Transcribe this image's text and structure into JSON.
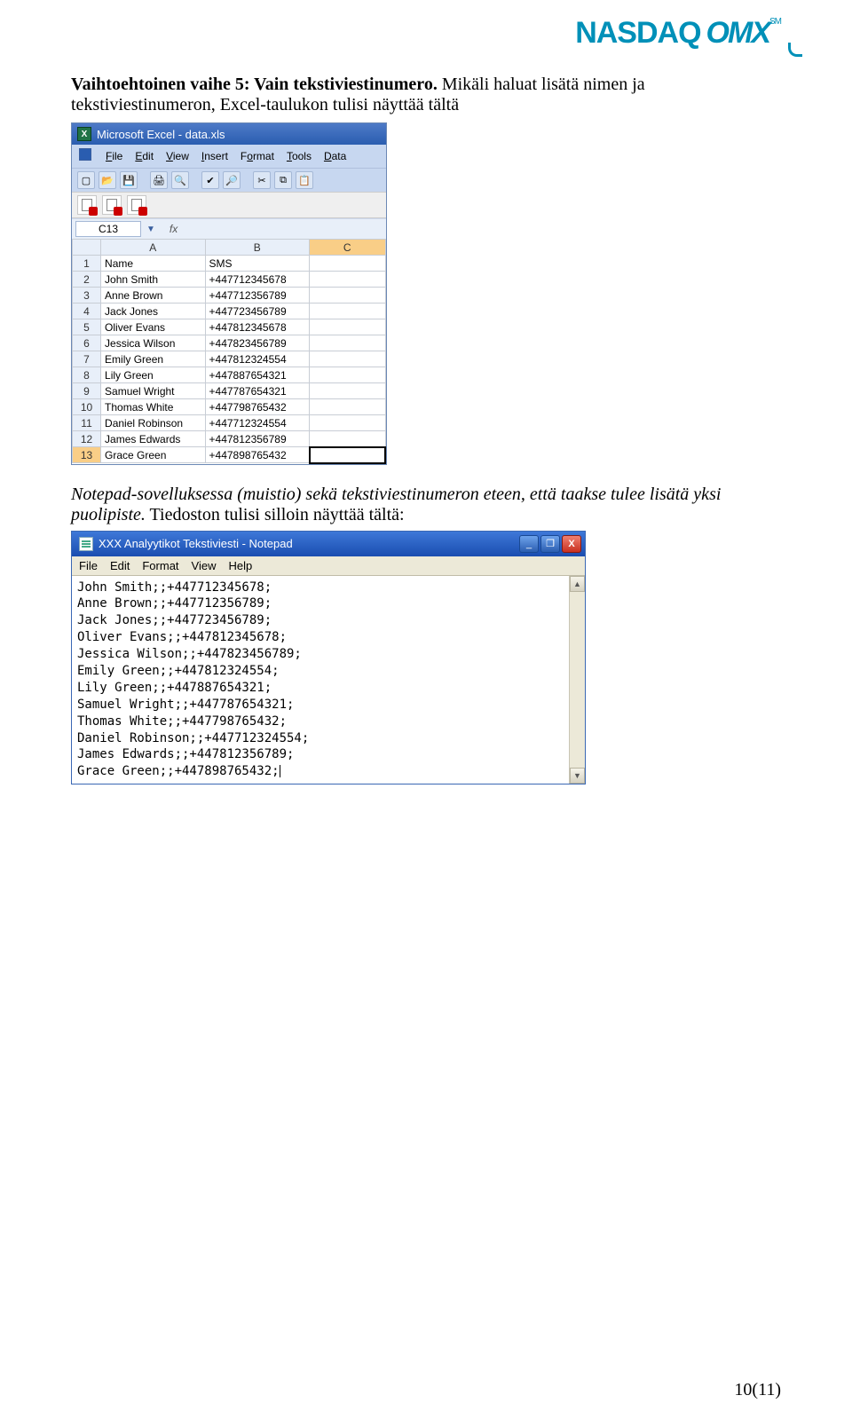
{
  "logo": {
    "main": "NASDAQ",
    "sub": "OMX",
    "mark": "SM"
  },
  "heading_prefix": "Vaihtoehtoinen vaihe 5: Vain tekstiviestinumero.",
  "intro_rest": " Mikäli haluat lisätä nimen ja tekstiviestinumeron, Excel-taulukon tulisi näyttää tältä",
  "excel": {
    "title": "Microsoft Excel - data.xls",
    "menu": {
      "file": "File",
      "edit": "Edit",
      "view": "View",
      "insert": "Insert",
      "format": "Format",
      "tools": "Tools",
      "data": "Data"
    },
    "namebox": "C13",
    "fx": "fx",
    "cols": [
      "A",
      "B",
      "C"
    ],
    "rows": [
      {
        "n": "1",
        "a": "Name",
        "b": "SMS"
      },
      {
        "n": "2",
        "a": "John Smith",
        "b": "+447712345678"
      },
      {
        "n": "3",
        "a": "Anne Brown",
        "b": "+447712356789"
      },
      {
        "n": "4",
        "a": "Jack Jones",
        "b": "+447723456789"
      },
      {
        "n": "5",
        "a": "Oliver Evans",
        "b": "+447812345678"
      },
      {
        "n": "6",
        "a": "Jessica Wilson",
        "b": "+447823456789"
      },
      {
        "n": "7",
        "a": "Emily Green",
        "b": "+447812324554"
      },
      {
        "n": "8",
        "a": "Lily Green",
        "b": "+447887654321"
      },
      {
        "n": "9",
        "a": "Samuel Wright",
        "b": "+447787654321"
      },
      {
        "n": "10",
        "a": "Thomas White",
        "b": "+447798765432"
      },
      {
        "n": "11",
        "a": "Daniel Robinson",
        "b": "+447712324554"
      },
      {
        "n": "12",
        "a": "James Edwards",
        "b": "+447812356789"
      },
      {
        "n": "13",
        "a": "Grace Green",
        "b": "+447898765432"
      }
    ]
  },
  "notepad_intro_italic": "Notepad-sovelluksessa (muistio) sekä tekstiviestinumeron eteen, että taakse tulee lisätä yksi puolipiste.",
  "notepad_intro_rest": " Tiedoston tulisi silloin näyttää tältä:",
  "notepad": {
    "title": "XXX Analyytikot Tekstiviesti - Notepad",
    "menu": {
      "file": "File",
      "edit": "Edit",
      "format": "Format",
      "view": "View",
      "help": "Help"
    },
    "lines": [
      "John Smith;;+447712345678;",
      "Anne Brown;;+447712356789;",
      "Jack Jones;;+447723456789;",
      "Oliver Evans;;+447812345678;",
      "Jessica Wilson;;+447823456789;",
      "Emily Green;;+447812324554;",
      "Lily Green;;+447887654321;",
      "Samuel Wright;;+447787654321;",
      "Thomas White;;+447798765432;",
      "Daniel Robinson;;+447712324554;",
      "James Edwards;;+447812356789;",
      "Grace Green;;+447898765432;"
    ]
  },
  "winbtn": {
    "min": "_",
    "max": "❐",
    "close": "X"
  },
  "footer": "10(11)"
}
